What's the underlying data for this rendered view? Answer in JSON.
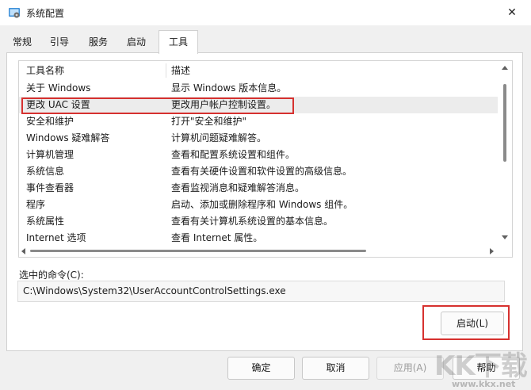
{
  "window": {
    "title": "系统配置",
    "close_symbol": "✕",
    "icon": "msconfig-app-icon"
  },
  "tabs": [
    {
      "label": "常规"
    },
    {
      "label": "引导"
    },
    {
      "label": "服务"
    },
    {
      "label": "启动"
    },
    {
      "label": "工具",
      "active": true
    }
  ],
  "tools_list": {
    "columns": [
      "工具名称",
      "描述"
    ],
    "rows": [
      {
        "name": "关于 Windows",
        "desc": "显示 Windows 版本信息。"
      },
      {
        "name": "更改 UAC 设置",
        "desc": "更改用户帐户控制设置。",
        "selected": true
      },
      {
        "name": "安全和维护",
        "desc": "打开\"安全和维护\""
      },
      {
        "name": "Windows 疑难解答",
        "desc": "计算机问题疑难解答。"
      },
      {
        "name": "计算机管理",
        "desc": "查看和配置系统设置和组件。"
      },
      {
        "name": "系统信息",
        "desc": "查看有关硬件设置和软件设置的高级信息。"
      },
      {
        "name": "事件查看器",
        "desc": "查看监视消息和疑难解答消息。"
      },
      {
        "name": "程序",
        "desc": "启动、添加或删除程序和 Windows 组件。"
      },
      {
        "name": "系统属性",
        "desc": "查看有关计算机系统设置的基本信息。"
      },
      {
        "name": "Internet 选项",
        "desc": "查看 Internet 属性。"
      }
    ]
  },
  "command": {
    "label": "选中的命令(C):",
    "value": "C:\\Windows\\System32\\UserAccountControlSettings.exe"
  },
  "buttons": {
    "launch": "启动(L)",
    "ok": "确定",
    "cancel": "取消",
    "apply": "应用(A)",
    "help": "帮助"
  },
  "watermark": {
    "brand": "KK下载",
    "url": "www.kkx.net"
  },
  "colors": {
    "highlight_annotation": "#d6312f",
    "selected_row": "#ececec"
  }
}
